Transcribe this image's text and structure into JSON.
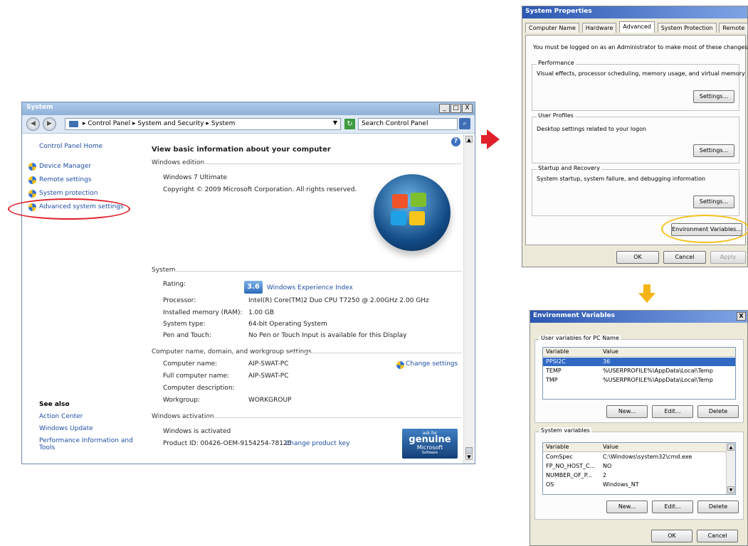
{
  "system_window": {
    "title": "System",
    "controls": {
      "minimize": "_",
      "maximize": "□",
      "close": "X"
    },
    "address_bar": {
      "breadcrumb": [
        "Control Panel",
        "System and Security",
        "System"
      ],
      "search_placeholder": "Search Control Panel"
    },
    "left_pane": {
      "home": "Control Panel Home",
      "links": [
        "Device Manager",
        "Remote settings",
        "System protection",
        "Advanced system settings"
      ],
      "see_also_title": "See also",
      "see_also": [
        "Action Center",
        "Windows Update",
        "Performance Information and",
        "Tools"
      ]
    },
    "main": {
      "heading": "View basic information about your computer",
      "windows_edition": {
        "title": "Windows edition",
        "edition": "Windows 7 Ultimate",
        "copyright": "Copyright © 2009 Microsoft Corporation.  All rights reserved."
      },
      "system": {
        "title": "System",
        "rating_label": "Rating:",
        "rating_value": "3.6",
        "rating_link": "Windows Experience Index",
        "processor_label": "Processor:",
        "processor_value": "Intel(R) Core(TM)2 Duo CPU    T7250  @ 2.00GHz   2.00 GHz",
        "memory_label": "Installed memory (RAM):",
        "memory_value": "1.00 GB",
        "type_label": "System type:",
        "type_value": "64-bit Operating System",
        "pen_label": "Pen and Touch:",
        "pen_value": "No Pen or Touch Input is available for this Display"
      },
      "computer_name": {
        "title": "Computer name, domain, and workgroup settings",
        "name_label": "Computer name:",
        "name_value": "AIP-SWAT-PC",
        "full_label": "Full computer name:",
        "full_value": "AIP-SWAT-PC",
        "desc_label": "Computer description:",
        "workgroup_label": "Workgroup:",
        "workgroup_value": "WORKGROUP",
        "change_link": "Change settings"
      },
      "activation": {
        "title": "Windows activation",
        "status": "Windows is activated",
        "product_id": "Product ID: 00426-OEM-9154254-78126",
        "change_key": "Change product key",
        "genuine": {
          "ask_for": "ask for",
          "word": "genuine",
          "microsoft": "Microsoft",
          "software": "Software"
        }
      }
    }
  },
  "system_properties": {
    "title": "System Properties",
    "tabs": [
      "Computer Name",
      "Hardware",
      "Advanced",
      "System Protection",
      "Remote"
    ],
    "active_tab": "Advanced",
    "admin_note": "You must be logged on as an Administrator to make most of these changes.",
    "performance": {
      "title": "Performance",
      "desc": "Visual effects, processor scheduling, memory usage, and virtual memory",
      "button": "Settings..."
    },
    "user_profiles": {
      "title": "User Profiles",
      "desc": "Desktop settings related to your logon",
      "button": "Settings..."
    },
    "startup": {
      "title": "Startup and Recovery",
      "desc": "System startup, system failure, and debugging information",
      "button": "Settings..."
    },
    "env_button": "Environment Variables...",
    "ok": "OK",
    "cancel": "Cancel",
    "apply": "Apply"
  },
  "environment_variables": {
    "title": "Environment Variables",
    "close": "X",
    "user_group": "User variables for PC Name",
    "columns": [
      "Variable",
      "Value"
    ],
    "user_vars": [
      {
        "name": "PPSI2C",
        "value": "36"
      },
      {
        "name": "TEMP",
        "value": "%USERPROFILE%\\AppData\\Local\\Temp"
      },
      {
        "name": "TMP",
        "value": "%USERPROFILE%\\AppData\\Local\\Temp"
      }
    ],
    "system_group": "System variables",
    "system_vars": [
      {
        "name": "ComSpec",
        "value": "C:\\Windows\\system32\\cmd.exe"
      },
      {
        "name": "FP_NO_HOST_C...",
        "value": "NO"
      },
      {
        "name": "NUMBER_OF_P...",
        "value": "2"
      },
      {
        "name": "OS",
        "value": "Windows_NT"
      }
    ],
    "new": "New...",
    "edit": "Edit...",
    "delete": "Delete",
    "ok": "OK",
    "cancel": "Cancel"
  }
}
